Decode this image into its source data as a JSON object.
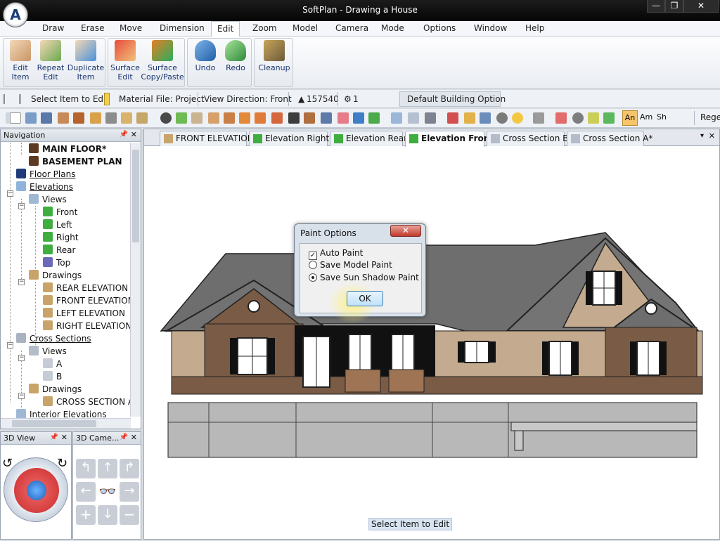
{
  "window": {
    "title": "SoftPlan - Drawing a House",
    "logo_letter": "A"
  },
  "menu": [
    "Draw",
    "Erase",
    "Move",
    "Dimension",
    "Edit",
    "Zoom",
    "Model",
    "Camera",
    "Mode",
    "Options",
    "Window",
    "Help"
  ],
  "menu_active": "Edit",
  "ribbon": [
    {
      "label": "Edit\nItem"
    },
    {
      "label": "Repeat\nEdit"
    },
    {
      "label": "Duplicate\nItem"
    },
    {
      "label": "Surface\nEdit"
    },
    {
      "label": "Surface\nCopy/Paste"
    },
    {
      "label": "Undo"
    },
    {
      "label": "Redo"
    },
    {
      "label": "Cleanup"
    }
  ],
  "infobar": {
    "select": "Select Item to Edit",
    "material": "Material File: Project",
    "view_direction": "View Direction: Front",
    "count": "157540",
    "layer": "1",
    "building_option": "Default Building Option"
  },
  "toolbar_right": {
    "an": "An",
    "am": "Am",
    "sh": "Sh",
    "rege": "Rege"
  },
  "navigation": {
    "title": "Navigation",
    "items": [
      "MAIN FLOOR*",
      "BASEMENT PLAN",
      "Floor Plans",
      "Elevations",
      "Views",
      "Front",
      "Left",
      "Right",
      "Rear",
      "Top",
      "Drawings",
      "REAR ELEVATION",
      "FRONT ELEVATION",
      "LEFT ELEVATION",
      "RIGHT ELEVATION",
      "Cross Sections",
      "Views",
      "A",
      "B",
      "Drawings",
      "CROSS SECTION A-",
      "Interior Elevations"
    ]
  },
  "panel_3d_view": "3D View",
  "panel_3d_camera": "3D Came...",
  "tabs": [
    "FRONT ELEVATION",
    "Elevation Right*",
    "Elevation Rear*",
    "Elevation Front*",
    "Cross Section B*",
    "Cross Section A*"
  ],
  "active_tab": "Elevation Front*",
  "dialog": {
    "title": "Paint Options",
    "close": "✕",
    "options": [
      "Auto Paint",
      "Save Model Paint",
      "Save Sun Shadow Paint"
    ],
    "auto_paint_checked": true,
    "selected_radio": "Save Sun Shadow Paint",
    "ok": "OK"
  },
  "status": "Select Item to Edit",
  "colors": {
    "brown": "#7a5b45",
    "tan": "#c4aa8e",
    "roof": "#6e6e6e",
    "concrete": "#b8b8b8",
    "accent": "#1f4e8c"
  }
}
